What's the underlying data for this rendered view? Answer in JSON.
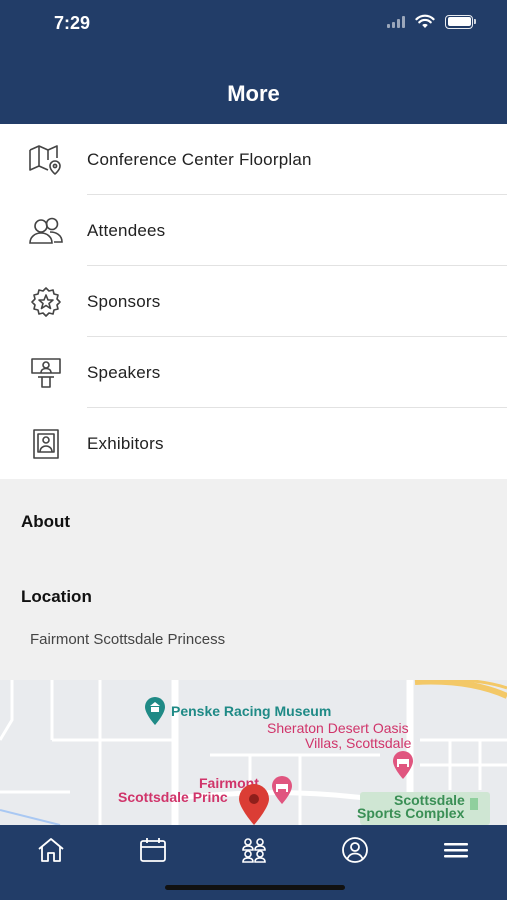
{
  "status_bar": {
    "time": "7:29"
  },
  "header": {
    "title": "More"
  },
  "menu": {
    "items": [
      {
        "label": "Conference Center Floorplan",
        "icon": "map-pin-icon"
      },
      {
        "label": "Attendees",
        "icon": "people-icon"
      },
      {
        "label": "Sponsors",
        "icon": "star-badge-icon"
      },
      {
        "label": "Speakers",
        "icon": "speaker-podium-icon"
      },
      {
        "label": "Exhibitors",
        "icon": "exhibitor-booth-icon"
      }
    ]
  },
  "about": {
    "heading": "About"
  },
  "location": {
    "heading": "Location",
    "address": "Fairmont Scottsdale Princess"
  },
  "map": {
    "labels": {
      "museum": "Penske Racing Museum",
      "sheraton_line1": "Sheraton Desert Oasis",
      "sheraton_line2": "Villas, Scottsdale",
      "fairmont_line1": "Fairmont",
      "fairmont_line2": "Scottsdale Princ",
      "sports_line1": "Scottsdale",
      "sports_line2": "Sports Complex"
    }
  },
  "tabbar": {
    "tabs": [
      {
        "icon": "home-icon"
      },
      {
        "icon": "calendar-icon"
      },
      {
        "icon": "people-group-icon"
      },
      {
        "icon": "profile-icon"
      },
      {
        "icon": "hamburger-menu-icon"
      }
    ]
  },
  "colors": {
    "navy": "#223d68",
    "map_pink": "#d0346a",
    "map_teal": "#1f8a86",
    "map_green": "#3a8f55",
    "pin_red": "#db3d35"
  }
}
